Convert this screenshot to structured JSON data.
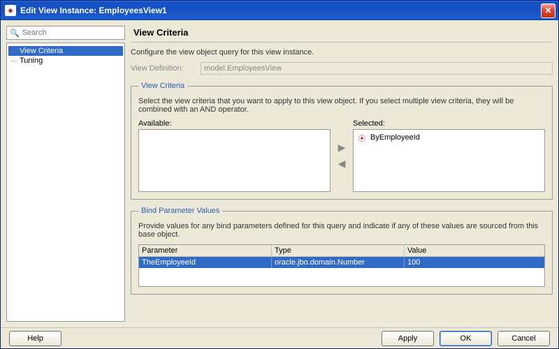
{
  "window": {
    "title": "Edit View Instance:  EmployeesView1"
  },
  "sidebar": {
    "search_placeholder": "Search",
    "items": [
      {
        "label": "View Criteria"
      },
      {
        "label": "Tuning"
      }
    ]
  },
  "page": {
    "title": "View Criteria",
    "intro": "Configure the view object query for this view instance.",
    "view_definition_label": "View Definition",
    "view_definition_value": "model.EmployeesView"
  },
  "criteria": {
    "legend": "View Criteria",
    "help": "Select the view criteria that you want to apply to this view object. If you select multiple view criteria, they will be combined with an AND operator.",
    "available_label": "Available",
    "selected_label": "Selected",
    "available": [],
    "selected": [
      {
        "label": "ByEmployeeId"
      }
    ]
  },
  "bind": {
    "legend": "Bind Parameter Values",
    "help": "Provide values for any bind parameters defined for this query and indicate if any of these values are sourced from this base object.",
    "columns": {
      "param": "Parameter",
      "type": "Type",
      "value": "Value"
    },
    "rows": [
      {
        "param": "TheEmployeeId",
        "type": "oracle.jbo.domain.Number",
        "value": "100"
      }
    ]
  },
  "buttons": {
    "help": "Help",
    "apply": "Apply",
    "ok": "OK",
    "cancel": "Cancel"
  }
}
